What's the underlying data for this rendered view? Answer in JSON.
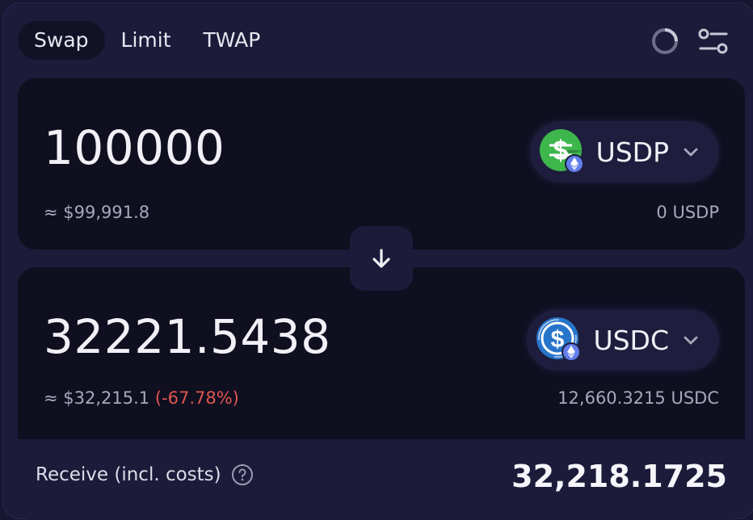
{
  "tabs": [
    {
      "label": "Swap",
      "active": true
    },
    {
      "label": "Limit",
      "active": false
    },
    {
      "label": "TWAP",
      "active": false
    }
  ],
  "icons": {
    "refresh": "refresh-ring-icon",
    "settings": "sliders-icon"
  },
  "sell": {
    "amount": "100000",
    "usd_value": "≈ $99,991.8",
    "token": "USDP",
    "balance": "0 USDP"
  },
  "buy": {
    "amount": "32221.5438",
    "usd_value": "≈ $32,215.1",
    "price_impact": "(-67.78%)",
    "token": "USDC",
    "balance": "12,660.3215 USDC"
  },
  "receive": {
    "label": "Receive (incl. costs)",
    "value": "32,218.1725"
  },
  "colors": {
    "background": "#1c1b3a",
    "card": "#0f0f20",
    "negative": "#e0564f",
    "usdp_green": "#3db64c",
    "usdc_blue": "#2775ca",
    "eth_purple": "#627eea"
  }
}
